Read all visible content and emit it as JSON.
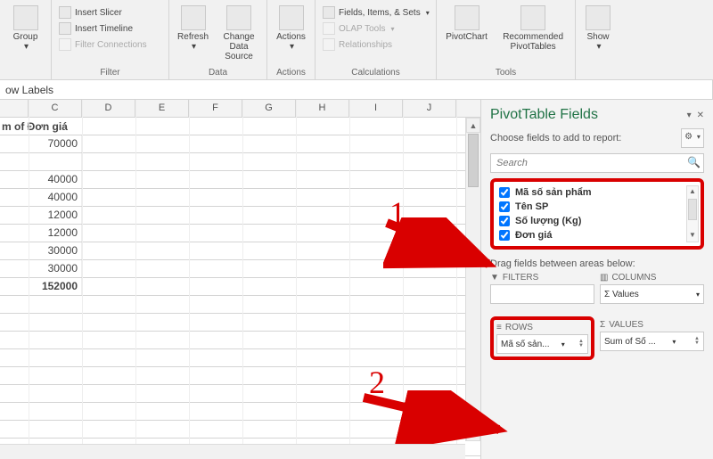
{
  "ribbon": {
    "groups": {
      "group": {
        "label": "Group",
        "caption": ""
      },
      "filter": {
        "caption": "Filter",
        "insert_slicer": "Insert Slicer",
        "insert_timeline": "Insert Timeline",
        "filter_connections": "Filter Connections"
      },
      "data": {
        "caption": "Data",
        "refresh": "Refresh",
        "change_data_source": "Change Data Source"
      },
      "actions": {
        "caption": "Actions",
        "label": "Actions"
      },
      "calculations": {
        "caption": "Calculations",
        "fields_items_sets": "Fields, Items, & Sets",
        "olap_tools": "OLAP Tools",
        "relationships": "Relationships"
      },
      "tools": {
        "caption": "Tools",
        "pivotchart": "PivotChart",
        "recommended": "Recommended PivotTables"
      },
      "show": {
        "caption": "",
        "label": "Show"
      }
    }
  },
  "formula_bar": {
    "text": "ow Labels"
  },
  "sheet": {
    "columns": [
      "C",
      "D",
      "E",
      "F",
      "G",
      "H",
      "I",
      "J"
    ],
    "sum_label": "m of Đơn giá",
    "values": [
      "70000",
      "",
      "40000",
      "40000",
      "12000",
      "12000",
      "30000",
      "30000",
      "152000"
    ],
    "bold_last": true
  },
  "pane": {
    "title": "PivotTable Fields",
    "subtitle": "Choose fields to add to report:",
    "search_placeholder": "Search",
    "fields": [
      "Mã số sản phẩm",
      "Tên SP",
      "Số lượng (Kg)",
      "Đơn giá"
    ],
    "drag_label": "Drag fields between areas below:",
    "areas": {
      "filters": {
        "label": "FILTERS",
        "value": ""
      },
      "columns": {
        "label": "COLUMNS",
        "value": "Σ Values"
      },
      "rows": {
        "label": "ROWS",
        "value": "Mã số sản..."
      },
      "values": {
        "label": "VALUES",
        "value": "Sum of Số ..."
      }
    }
  },
  "annotations": {
    "one": "1",
    "two": "2"
  }
}
